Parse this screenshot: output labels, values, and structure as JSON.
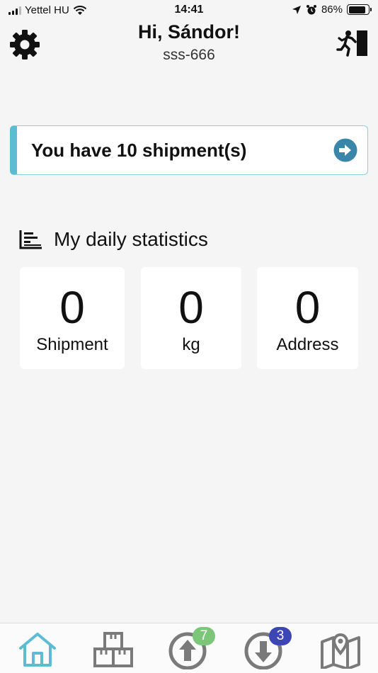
{
  "status_bar": {
    "carrier": "Yettel HU",
    "time": "14:41",
    "battery": "86%",
    "battery_level": 0.86
  },
  "header": {
    "greeting": "Hi, Sándor!",
    "courier_id": "sss-666",
    "settings_icon": "gear-icon",
    "logout_icon": "exit-icon"
  },
  "shipment_card": {
    "text": "You have 10 shipment(s)",
    "icon": "arrow-right-circle-icon"
  },
  "stats": {
    "title": "My daily statistics",
    "icon": "bar-chart-icon",
    "items": [
      {
        "value": "0",
        "label": "Shipment"
      },
      {
        "value": "0",
        "label": "kg"
      },
      {
        "value": "0",
        "label": "Address"
      }
    ]
  },
  "tabs": {
    "items": [
      {
        "icon": "home-icon",
        "active": true
      },
      {
        "icon": "boxes-icon",
        "active": false
      },
      {
        "icon": "upload-arrow-icon",
        "badge": "7",
        "active": false
      },
      {
        "icon": "download-arrow-icon",
        "badge": "3",
        "active": false
      },
      {
        "icon": "map-icon",
        "active": false
      }
    ]
  },
  "colors": {
    "accent": "#5cbcd3",
    "arrow_circle": "#3a85aa",
    "badge_green": "#7cc67a",
    "badge_blue": "#3c46b5",
    "icon_gray": "#7a7a7a"
  }
}
